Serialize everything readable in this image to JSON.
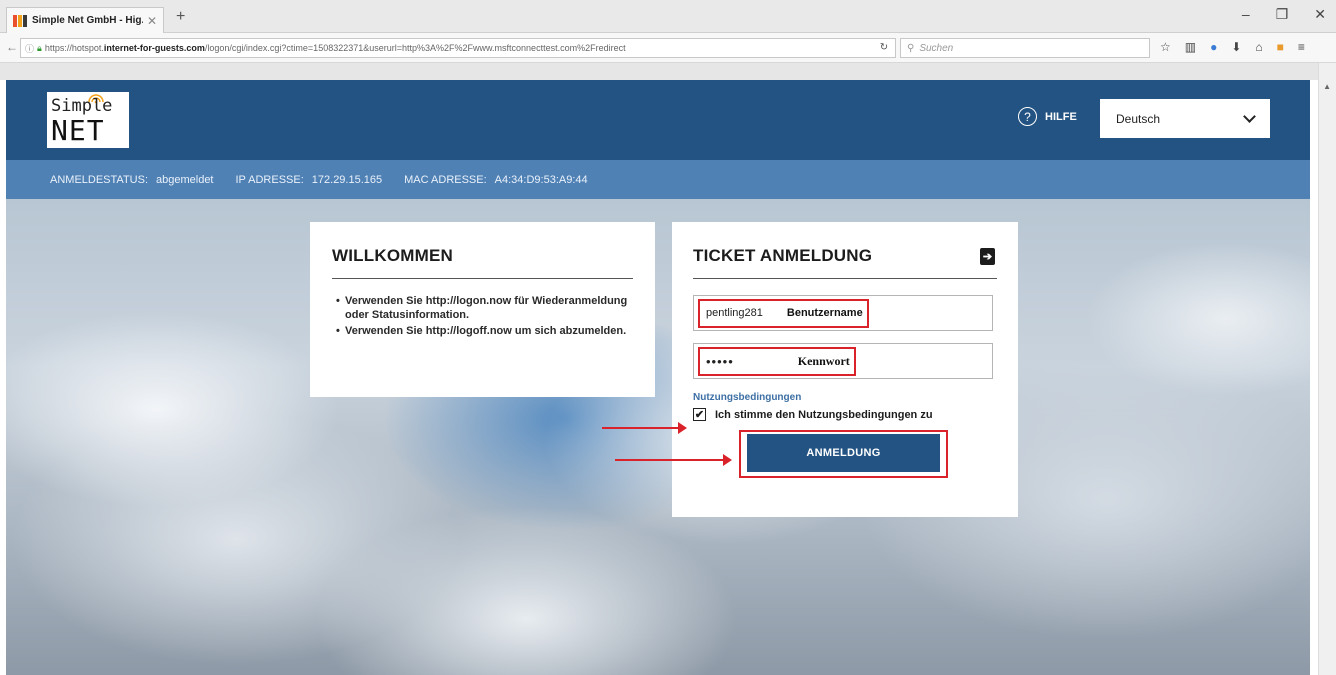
{
  "browser": {
    "tab_title": "Simple Net GmbH - Hig...",
    "tab_close": "✕",
    "new_tab": "+",
    "window_controls": [
      "–",
      "❐",
      "✕"
    ],
    "url_prefix": "https://hotspot.",
    "url_domain": "internet-for-guests.com",
    "url_rest": "/logon/cgi/index.cgi?ctime=1508322371&userurl=http%3A%2F%2Fwww.msftconnecttest.com%2Fredirect",
    "search_placeholder": "Suchen",
    "icons": [
      "star-icon",
      "library-icon",
      "extension-icon",
      "download-icon",
      "home-icon",
      "pocket-icon",
      "menu-icon"
    ]
  },
  "header": {
    "logo_top": "Simple",
    "logo_bottom": "NET",
    "help_label": "HILFE",
    "help_icon": "?",
    "language": "Deutsch"
  },
  "status": {
    "items": [
      {
        "label": "ANMELDESTATUS:",
        "value": "abgemeldet"
      },
      {
        "label": "IP ADRESSE:",
        "value": "172.29.15.165"
      },
      {
        "label": "MAC ADRESSE:",
        "value": "A4:34:D9:53:A9:44"
      }
    ]
  },
  "welcome": {
    "title": "WILLKOMMEN",
    "items": [
      "Verwenden Sie http://logon.now für Wiederanmeldung oder Statusinformation.",
      "Verwenden Sie http://logoff.now um sich abzumelden."
    ]
  },
  "ticket": {
    "title": "TICKET ANMELDUNG",
    "username_value": "pentling281",
    "username_label": "Benutzername",
    "password_value": "•••••",
    "password_label": "Kennwort",
    "terms_link": "Nutzungsbedingungen",
    "terms_checkbox": "Ich stimme den Nutzungsbedingungen zu",
    "checkbox_mark": "✔",
    "submit": "ANMELDUNG"
  },
  "colors": {
    "header_blue": "#235382",
    "status_blue": "#4f81b5",
    "annotation_red": "#d9222a",
    "link_blue": "#3d6fa4"
  }
}
